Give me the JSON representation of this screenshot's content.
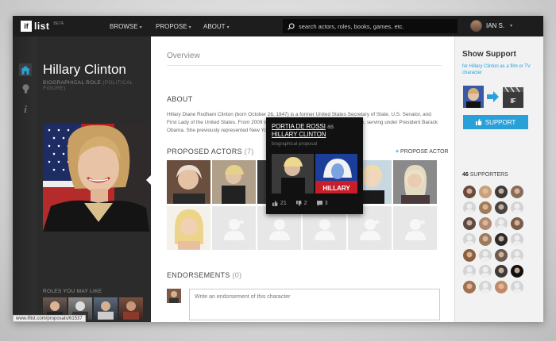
{
  "app": {
    "logo_mark": "if",
    "logo_text": "list",
    "logo_badge": "BETA"
  },
  "nav": {
    "items": [
      {
        "label": "BROWSE"
      },
      {
        "label": "PROPOSE"
      },
      {
        "label": "ABOUT"
      }
    ]
  },
  "search": {
    "placeholder": "search actors, roles, books, games, etc."
  },
  "user": {
    "name": "IAN S."
  },
  "character": {
    "name": "Hillary Clinton",
    "role_type": "BIOGRAPHICAL ROLE",
    "role_category": "(POLITICAL FIGURE)"
  },
  "tabs": {
    "overview": "Overview"
  },
  "about": {
    "title": "ABOUT",
    "text": "Hillary Diane Rodham Clinton (born October 26, 1947) is a former United States Secretary of State, U.S. Senator, and First Lady of the United States. From 2009 to 2013, she was the 67th Secretary of State, serving under President Barack Obama. She previously represented New York in the U.S. Senate...",
    "more": "more"
  },
  "proposed": {
    "title": "PROPOSED ACTORS",
    "count": "(7)",
    "propose_link": "PROPOSE ACTOR"
  },
  "popup": {
    "actor": "PORTIA DE ROSSI",
    "as": "as",
    "character": "HILLARY CLINTON",
    "subtitle": "biographical proposal",
    "likes": "21",
    "dislikes": "2",
    "comments": "3",
    "poster_text": "HILLARY"
  },
  "endorsements": {
    "title": "ENDORSEMENTS",
    "count": "(0)",
    "placeholder": "Write an endorsement of this character"
  },
  "roles": {
    "title": "ROLES YOU MAY LIKE"
  },
  "support": {
    "title": "Show Support",
    "description": "for Hillary Clinton as a film or TV character",
    "button": "SUPPORT",
    "poster_text": "IF"
  },
  "supporters": {
    "count": "46",
    "label": "SUPPORTERS"
  },
  "status": {
    "url": "www.iflist.com/proposals/61537"
  },
  "colors": {
    "accent": "#2aa0d8",
    "topbar": "#1d1d1d",
    "sidebar": "#2b2b2b"
  }
}
